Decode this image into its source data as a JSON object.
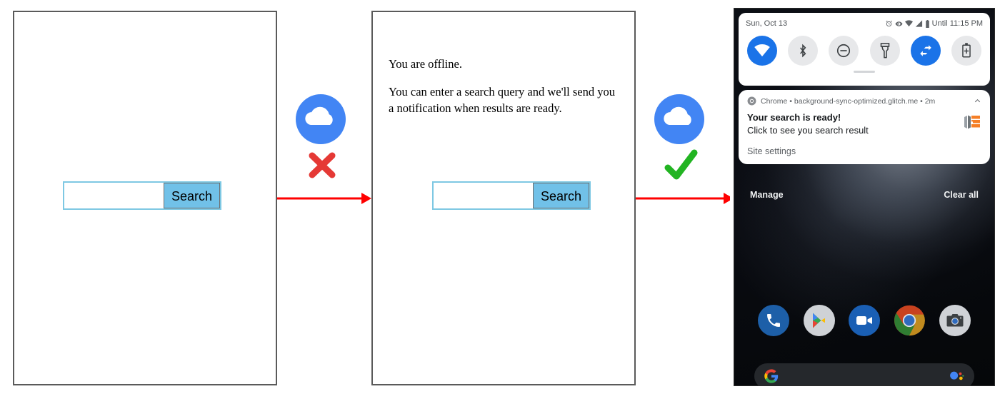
{
  "colors": {
    "panel_border": "#5a5a5a",
    "search_border": "#7ec8e3",
    "search_button_bg": "#71c1e8",
    "cloud_blue": "#4285f4",
    "error_red": "#e53935",
    "arrow_red": "#ff0000",
    "success_green": "#22b422",
    "android_accent": "#1a73e8",
    "glitch_orange": "#f57f26"
  },
  "panel_offline": {
    "name": "offline-search-page",
    "search": {
      "input_value": "",
      "input_placeholder": "",
      "button_label": "Search"
    }
  },
  "connector_fail": {
    "cloud_icon": "cloud-icon",
    "status_icon": "red-x-icon",
    "arrow_icon": "right-arrow-icon"
  },
  "connector_success": {
    "cloud_icon": "cloud-icon",
    "status_icon": "green-check-icon",
    "arrow_icon": "right-arrow-icon"
  },
  "panel_message": {
    "name": "offline-message-page",
    "line_1": "You are offline.",
    "line_2": "You can enter a search query and we'll send you a notification when results are ready.",
    "search": {
      "input_value": "",
      "input_placeholder": "",
      "button_label": "Search"
    }
  },
  "phone": {
    "status_bar": {
      "date": "Sun, Oct 13",
      "dnd_until": "Until 11:15 PM",
      "icons": [
        "alarm-icon",
        "dnd-eye-icon",
        "wifi-icon",
        "signal-icon",
        "battery-icon"
      ]
    },
    "quick_settings": {
      "tiles": [
        {
          "name": "wifi-tile",
          "icon": "wifi-icon",
          "active": true
        },
        {
          "name": "bluetooth-tile",
          "icon": "bluetooth-icon",
          "active": false
        },
        {
          "name": "do-not-disturb-tile",
          "icon": "do-not-disturb-icon",
          "active": false
        },
        {
          "name": "flashlight-tile",
          "icon": "flashlight-icon",
          "active": false
        },
        {
          "name": "auto-rotate-tile",
          "icon": "auto-rotate-icon",
          "active": true
        },
        {
          "name": "battery-saver-tile",
          "icon": "battery-saver-icon",
          "active": false
        }
      ]
    },
    "notification": {
      "app_icon": "chrome-icon",
      "source": "Chrome • background-sync-optimized.glitch.me • 2m",
      "collapse_icon": "chevron-up-icon",
      "title": "Your search is ready!",
      "subtitle": "Click to see you search result",
      "large_icon": "glitch-logo-icon",
      "action_label": "Site settings"
    },
    "shade_footer": {
      "manage_label": "Manage",
      "clear_all_label": "Clear all"
    },
    "dock": [
      {
        "name": "dock-icon-phone",
        "icon": "phone-icon"
      },
      {
        "name": "dock-icon-play-store",
        "icon": "play-store-icon"
      },
      {
        "name": "dock-icon-duo",
        "icon": "video-camera-icon"
      },
      {
        "name": "dock-icon-chrome",
        "icon": "chrome-icon"
      },
      {
        "name": "dock-icon-camera",
        "icon": "camera-icon"
      }
    ],
    "google_pill": {
      "left_icon": "google-g-icon",
      "right_icon": "google-assistant-icon",
      "query": ""
    }
  }
}
